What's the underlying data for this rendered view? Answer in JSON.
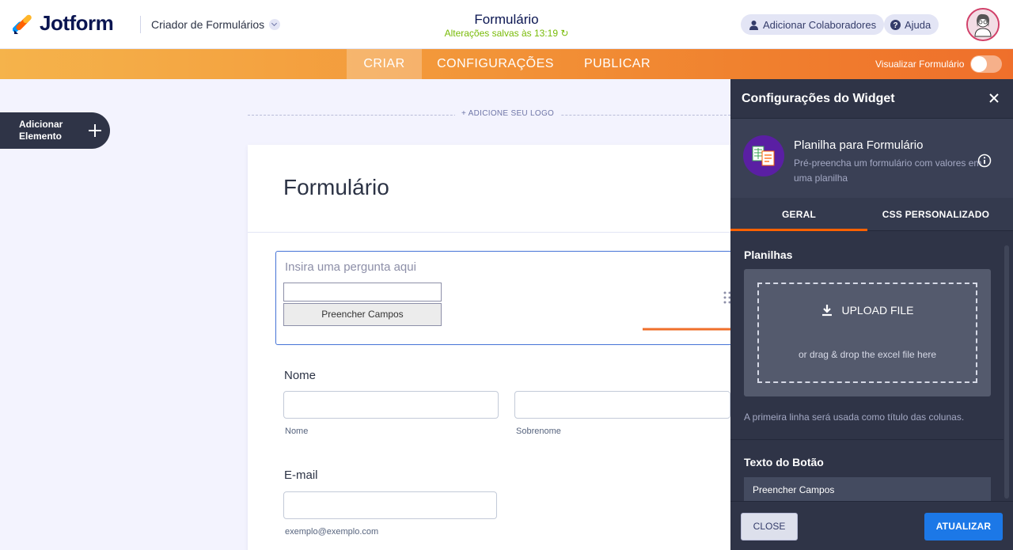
{
  "header": {
    "logo_text": "Jotform",
    "builder_label": "Criador de Formulários",
    "form_name": "Formulário",
    "saved_status": "Alterações salvas às 13:19",
    "collaborators_label": "Adicionar Colaboradores",
    "help_label": "Ajuda"
  },
  "nav": {
    "tabs": [
      {
        "label": "CRIAR"
      },
      {
        "label": "CONFIGURAÇÕES"
      },
      {
        "label": "PUBLICAR"
      }
    ],
    "preview_label": "Visualizar Formulário"
  },
  "canvas": {
    "add_element_line1": "Adicionar",
    "add_element_line2": "Elemento",
    "add_logo": "+ ADICIONE SEU LOGO",
    "form_heading": "Formulário",
    "widget": {
      "question_placeholder": "Insira uma pergunta aqui",
      "button_label": "Preencher Campos"
    },
    "name_field": {
      "label": "Nome",
      "first_sublabel": "Nome",
      "last_sublabel": "Sobrenome"
    },
    "email_field": {
      "label": "E-mail",
      "sublabel": "exemplo@exemplo.com"
    }
  },
  "panel": {
    "title": "Configurações do Widget",
    "widget_name": "Planilha para Formulário",
    "widget_desc": "Pré-preencha um formulário com valores em uma planilha",
    "tabs": [
      {
        "label": "GERAL"
      },
      {
        "label": "CSS PERSONALIZADO"
      }
    ],
    "sheets_label": "Planilhas",
    "upload_label": "UPLOAD FILE",
    "drag_label": "or drag & drop the excel file here",
    "hint": "A primeira linha será usada como título das colunas.",
    "button_text_label": "Texto do Botão",
    "button_text_value": "Preencher Campos",
    "close_label": "CLOSE",
    "update_label": "ATUALIZAR"
  },
  "colors": {
    "accent_orange": "#ff6100",
    "primary_blue": "#1c78e7",
    "selected_border": "#4573d6",
    "saved_green": "#78bb07"
  }
}
